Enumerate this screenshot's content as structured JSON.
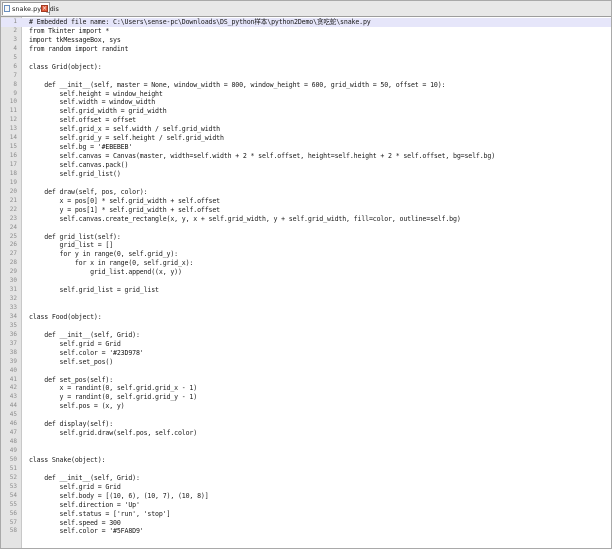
{
  "editor": {
    "tab": {
      "filename": "snake.pyw_dis",
      "close_icon": "close-icon"
    },
    "colors": {
      "background": "#ffffff",
      "gutter": "#e4e4e4",
      "current_line": "#e6e6fa",
      "text": "#1a1a1a",
      "line_number": "#8a8a8a"
    },
    "current_line": 1,
    "lines": [
      "# Embedded file name: C:\\Users\\sense-pc\\Downloads\\DS_python样本\\python2Demo\\贪吃蛇\\snake.py",
      "from Tkinter import *",
      "import tkMessageBox, sys",
      "from random import randint",
      "",
      "class Grid(object):",
      "",
      "    def __init__(self, master = None, window_width = 800, window_height = 600, grid_width = 50, offset = 10):",
      "        self.height = window_height",
      "        self.width = window_width",
      "        self.grid_width = grid_width",
      "        self.offset = offset",
      "        self.grid_x = self.width / self.grid_width",
      "        self.grid_y = self.height / self.grid_width",
      "        self.bg = '#EBEBEB'",
      "        self.canvas = Canvas(master, width=self.width + 2 * self.offset, height=self.height + 2 * self.offset, bg=self.bg)",
      "        self.canvas.pack()",
      "        self.grid_list()",
      "",
      "    def draw(self, pos, color):",
      "        x = pos[0] * self.grid_width + self.offset",
      "        y = pos[1] * self.grid_width + self.offset",
      "        self.canvas.create_rectangle(x, y, x + self.grid_width, y + self.grid_width, fill=color, outline=self.bg)",
      "",
      "    def grid_list(self):",
      "        grid_list = []",
      "        for y in range(0, self.grid_y):",
      "            for x in range(0, self.grid_x):",
      "                grid_list.append((x, y))",
      "",
      "        self.grid_list = grid_list",
      "",
      "",
      "class Food(object):",
      "",
      "    def __init__(self, Grid):",
      "        self.grid = Grid",
      "        self.color = '#23D978'",
      "        self.set_pos()",
      "",
      "    def set_pos(self):",
      "        x = randint(0, self.grid.grid_x - 1)",
      "        y = randint(0, self.grid.grid_y - 1)",
      "        self.pos = (x, y)",
      "",
      "    def display(self):",
      "        self.grid.draw(self.pos, self.color)",
      "",
      "",
      "class Snake(object):",
      "",
      "    def __init__(self, Grid):",
      "        self.grid = Grid",
      "        self.body = [(10, 6), (10, 7), (10, 8)]",
      "        self.direction = 'Up'",
      "        self.status = ['run', 'stop']",
      "        self.speed = 300",
      "        self.color = '#5FA8D9'"
    ]
  }
}
